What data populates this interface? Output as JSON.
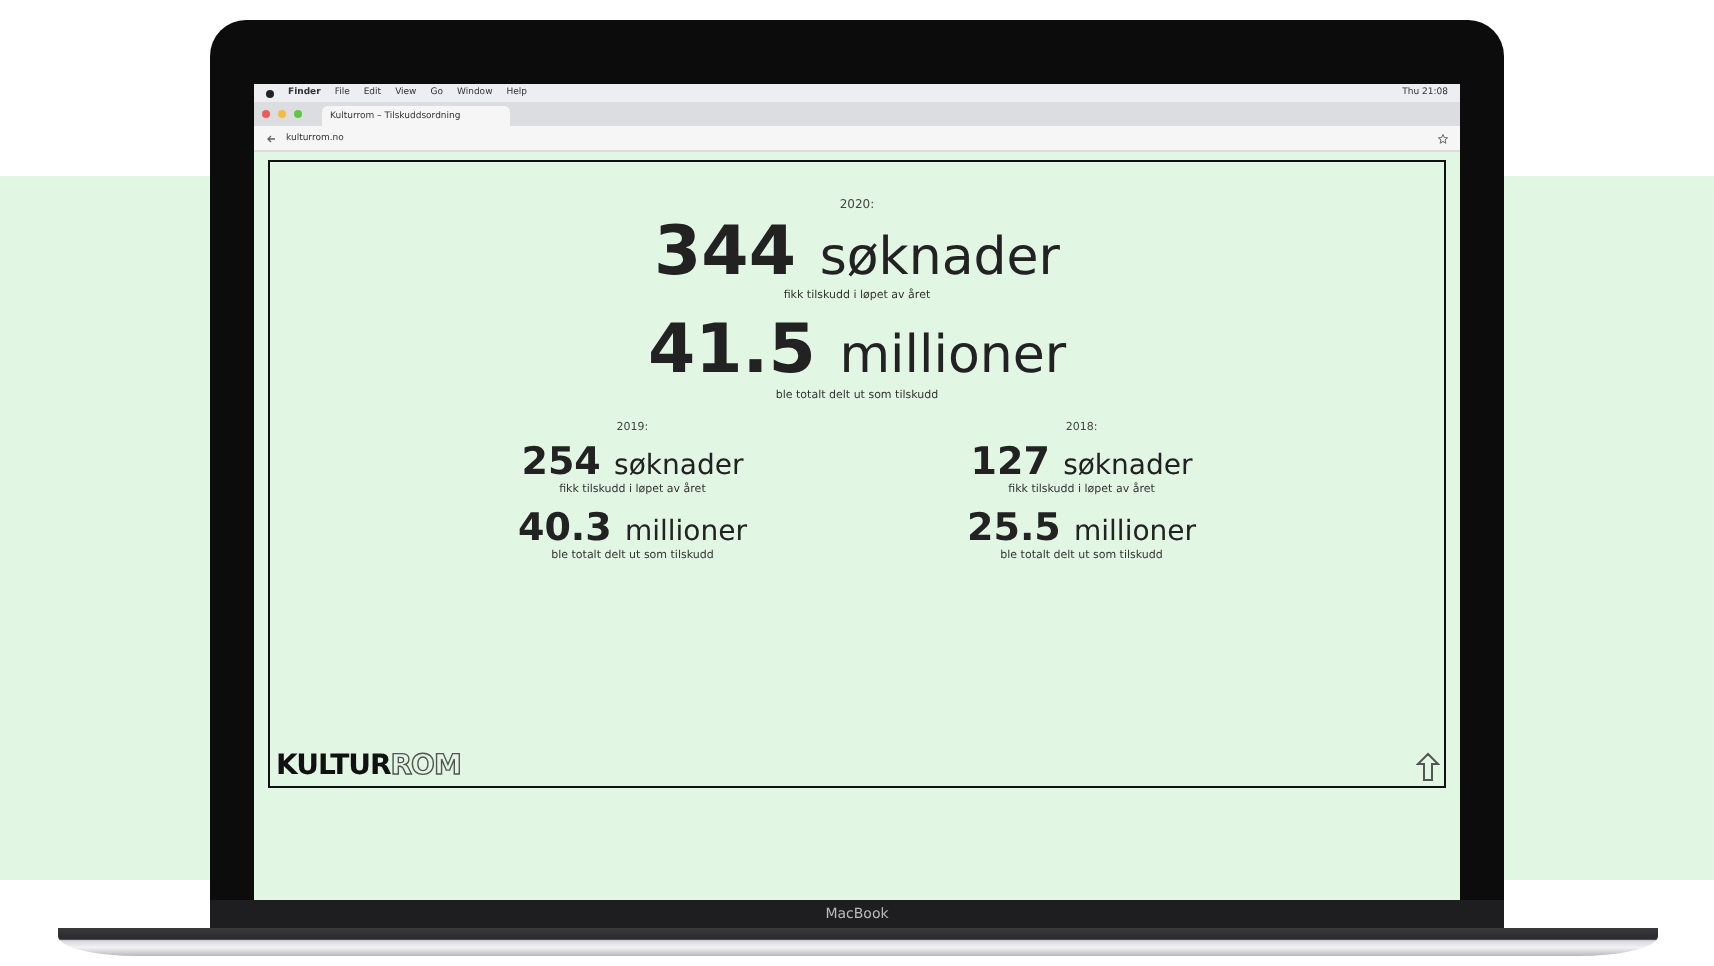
{
  "menu_bar": {
    "items": [
      "Finder",
      "File",
      "Edit",
      "View",
      "Go",
      "Window",
      "Help"
    ],
    "clock": "Thu 21:08"
  },
  "browser": {
    "tab": "Kulturrom – Tilskuddsordning",
    "url": "kulturrom.no"
  },
  "featured_year": {
    "year": "2020:",
    "stats": [
      {
        "number": "344",
        "unit": "søknader",
        "caption": "fikk tilskudd i løpet av året"
      },
      {
        "number": "41.5",
        "unit": "millioner",
        "caption": "ble totalt delt ut som tilskudd"
      }
    ]
  },
  "previous_years": [
    {
      "year": "2019:",
      "stats": [
        {
          "number": "254",
          "unit": "søknader",
          "caption": "fikk tilskudd i løpet av året"
        },
        {
          "number": "40.3",
          "unit": "millioner",
          "caption": "ble totalt delt ut som tilskudd"
        }
      ]
    },
    {
      "year": "2018:",
      "stats": [
        {
          "number": "127",
          "unit": "søknader",
          "caption": "fikk tilskudd i løpet av året"
        },
        {
          "number": "25.5",
          "unit": "millioner",
          "caption": "ble totalt delt ut som tilskudd"
        }
      ]
    }
  ],
  "logo": {
    "solid": "KULTUR",
    "outline": "ROM"
  },
  "laptop_label": "MacBook"
}
